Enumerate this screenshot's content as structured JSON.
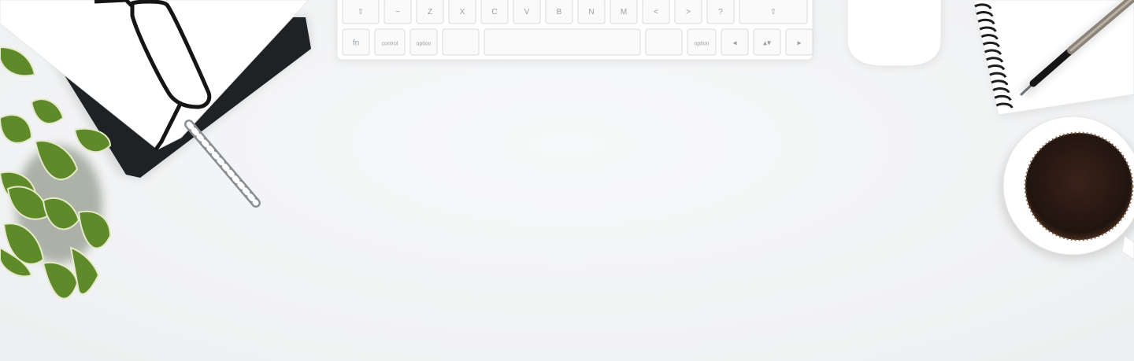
{
  "scene": {
    "description_kind": "flat-lay desk photo",
    "colors": {
      "desk": "#f3f4f5",
      "keyboard": "#ffffff",
      "key": "#fafafa",
      "key_border": "#dcdfe2",
      "notebook_black": "#1f2224",
      "notebook_white": "#ffffff",
      "plant_leaf": "#5f8a2a",
      "plant_leaf_edge": "#e6e9c9",
      "coffee": "#2b1a14",
      "cup": "#ffffff",
      "pen": "#2a2a2a"
    },
    "icons": [
      "glasses-icon",
      "pen-icon",
      "plant-icon",
      "mouse-icon",
      "coffee-cup-icon",
      "spiral-notebook-icon"
    ]
  },
  "keyboard": {
    "row1": [
      "⇧",
      "~",
      "Z",
      "X",
      "C",
      "V",
      "B",
      "N",
      "M",
      "<",
      ">",
      "?",
      "⇧"
    ],
    "row2": [
      "fn",
      "control",
      "option",
      "",
      "",
      "",
      "option",
      "◂",
      "▴▾",
      "▸"
    ]
  }
}
